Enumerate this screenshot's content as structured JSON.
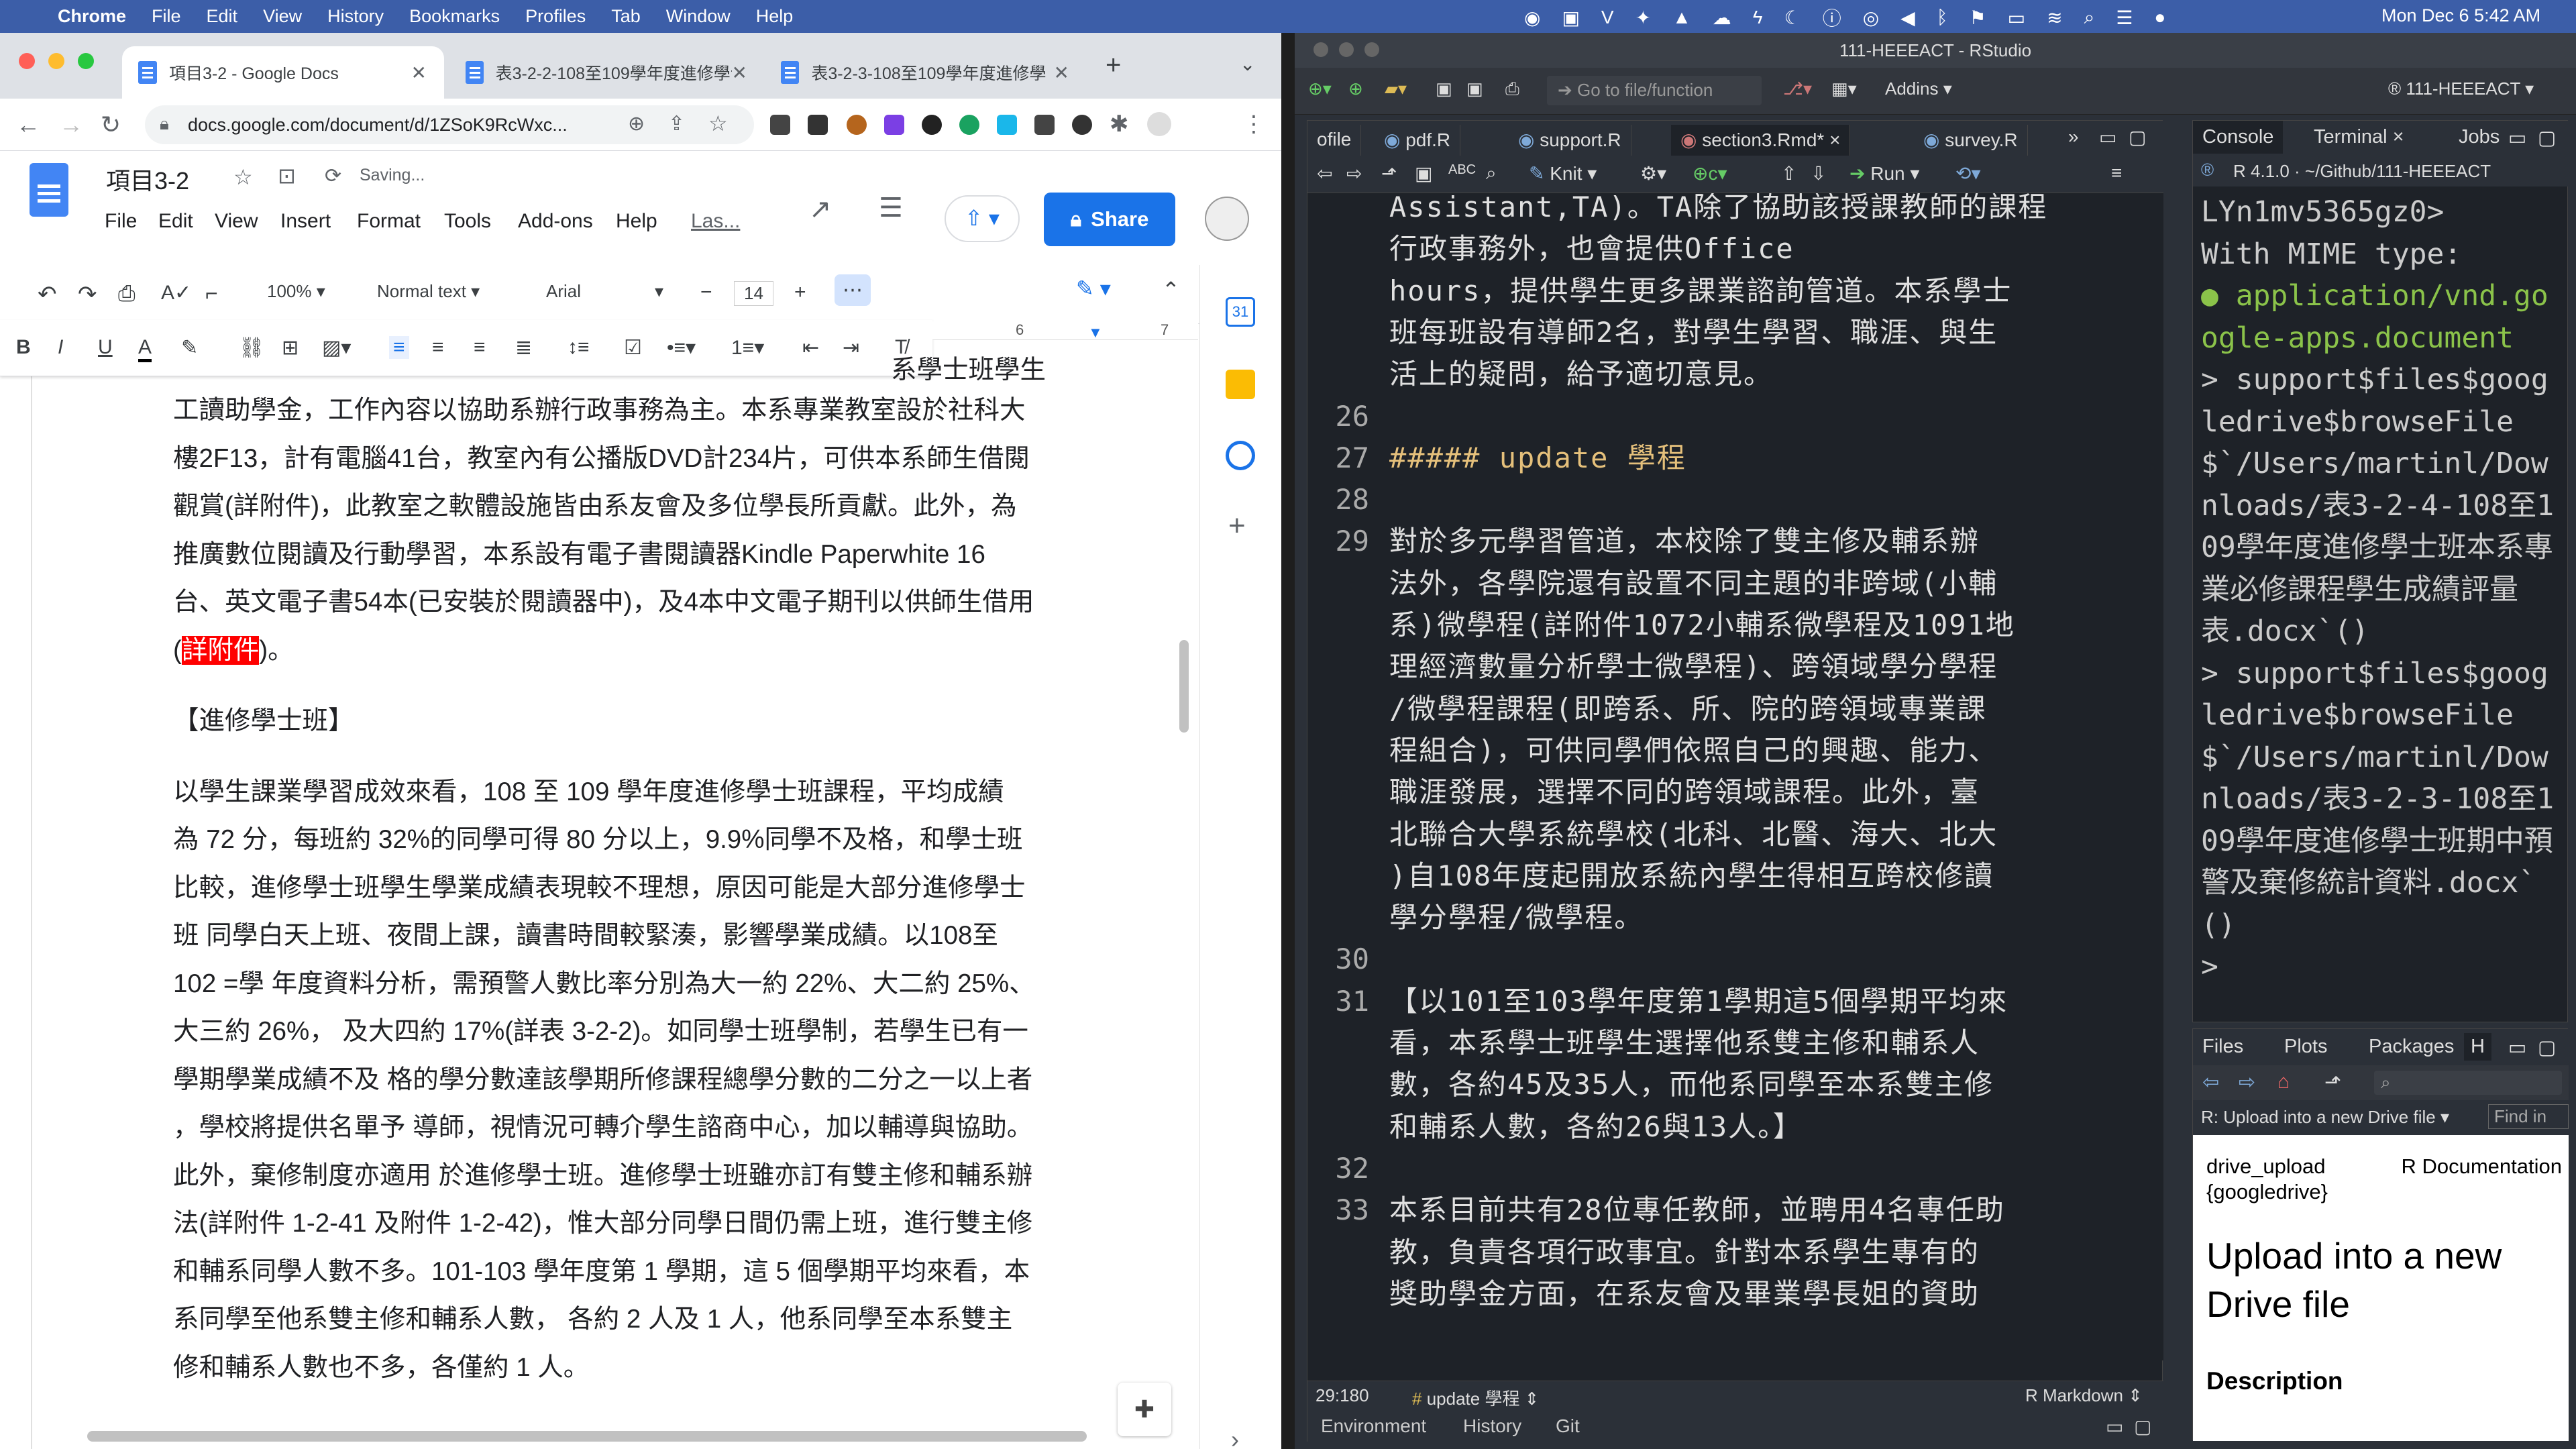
{
  "menubar": {
    "app": "Chrome",
    "items": [
      "File",
      "Edit",
      "View",
      "History",
      "Bookmarks",
      "Profiles",
      "Tab",
      "Window",
      "Help"
    ],
    "datetime": "Mon Dec 6  5:42 AM"
  },
  "chrome": {
    "tabs": [
      {
        "label": "項目3-2 - Google Docs"
      },
      {
        "label": "表3-2-2-108至109學年度進修學士班"
      },
      {
        "label": "表3-2-3-108至109學年度進修學"
      }
    ],
    "url": "docs.google.com/document/d/1ZSoK9RcWxc...",
    "doc_title": "項目3-2",
    "saving": "Saving...",
    "share": "Share",
    "menu": [
      "File",
      "Edit",
      "View",
      "Insert",
      "Format",
      "Tools",
      "Add-ons",
      "Help",
      "Las..."
    ],
    "zoom": "100%",
    "style": "Normal text",
    "font": "Arial",
    "size": "14",
    "ruler": [
      "6",
      "7"
    ]
  },
  "doc": {
    "para1_line0": "系學士班學生",
    "para1_lines": [
      "工讀助學金，工作內容以協助系辦行政事務為主。本系專業教室設於社科大",
      "樓2F13，計有電腦41台，教室內有公播版DVD計234片，可供本系師生借閱",
      "觀賞(詳附件)，此教室之軟體設施皆由系友會及多位學長所貢獻。此外，為",
      "推廣數位閱讀及行動學習，本系設有電子書閱讀器Kindle Paperwhite 16",
      "台、英文電子書54本(已安裝於閱讀器中)，及4本中文電子期刊以供師生借用"
    ],
    "para1_last_pre": "(",
    "para1_highlight": "詳附件",
    "para1_last_post": ")。",
    "heading": "【進修學士班】",
    "para2_lines": [
      "以學生課業學習成效來看，108 至 109 學年度進修學士班課程，平均成績",
      "為 72 分，每班約 32%的同學可得 80 分以上，9.9%同學不及格，和學士班",
      "比較，進修學士班學生學業成績表現較不理想，原因可能是大部分進修學士",
      "班 同學白天上班、夜間上課，讀書時間較緊湊，影響學業成績。以108至",
      "102 =學 年度資料分析，需預警人數比率分別為大一約 22%、大二約 25%、",
      "大三約 26%， 及大四約 17%(詳表 3-2-2)。如同學士班學制，若學生已有一",
      "學期學業成績不及 格的學分數達該學期所修課程總學分數的二分之一以上者",
      "，學校將提供名單予 導師，視情況可轉介學生諮商中心，加以輔導與協助。",
      "此外，棄修制度亦適用 於進修學士班。進修學士班雖亦訂有雙主修和輔系辦",
      "法(詳附件 1-2-41 及附件 1-2-42)，惟大部分同學日間仍需上班，進行雙主修",
      "和輔系同學人數不多。101-103 學年度第 1 學期，這 5 個學期平均來看，本",
      "系同學至他系雙主修和輔系人數， 各約 2 人及 1 人，他系同學至本系雙主",
      "修和輔系人數也不多，各僅約 1 人。"
    ]
  },
  "rstudio": {
    "title": "111-HEEEACT - RStudio",
    "goto": "Go to file/function",
    "addins": "Addins",
    "project": "111-HEEEACT",
    "editor_tabs": [
      "ofile",
      "pdf.R",
      "support.R",
      "section3.Rmd*",
      "survey.R"
    ],
    "knit": "Knit",
    "run": "Run",
    "code_top": [
      "Assistant,TA)。TA除了協助該授課教師的課程",
      "行政事務外，也會提供Office",
      "hours，提供學生更多課業諮詢管道。本系學士",
      "班每班設有導師2名，對學生學習、職涯、與生",
      "活上的疑問，給予適切意見。"
    ],
    "lines": [
      {
        "n": "26",
        "t": [
          ""
        ]
      },
      {
        "n": "27",
        "t": [
          "##### update 學程"
        ],
        "hdr": true
      },
      {
        "n": "28",
        "t": [
          ""
        ]
      },
      {
        "n": "29",
        "t": [
          "對於多元學習管道，本校除了雙主修及輔系辦",
          "法外，各學院還有設置不同主題的非跨域(小輔",
          "系)微學程(詳附件1072小輔系微學程及1091地",
          "理經濟數量分析學士微學程)、跨領域學分學程",
          "/微學程課程(即跨系、所、院的跨領域專業課",
          "程組合)，可供同學們依照自己的興趣、能力、",
          "職涯發展，選擇不同的跨領域課程。此外，臺",
          "北聯合大學系統學校(北科、北醫、海大、北大",
          ")自108年度起開放系統內學生得相互跨校修讀",
          "學分學程/微學程。"
        ]
      },
      {
        "n": "30",
        "t": [
          ""
        ]
      },
      {
        "n": "31",
        "t": [
          "【以101至103學年度第1學期這5個學期平均來",
          "看，本系學士班學生選擇他系雙主修和輔系人",
          "數，各約45及35人，而他系同學至本系雙主修",
          "和輔系人數，各約26與13人。】"
        ]
      },
      {
        "n": "32",
        "t": [
          ""
        ]
      },
      {
        "n": "33",
        "t": [
          "本系目前共有28位專任教師，並聘用4名專任助",
          "教，負責各項行政事宜。針對本系學生專有的",
          "獎助學金方面，在系友會及畢業學長姐的資助"
        ]
      }
    ],
    "status_pos": "29:180",
    "status_section": "update 學程",
    "status_mode": "R Markdown",
    "env_tabs": [
      "Environment",
      "History",
      "Git"
    ],
    "console_tabs": [
      "Console",
      "Terminal",
      "Jobs"
    ],
    "r_version": "R 4.1.0 · ~/Github/111-HEEEACT",
    "console_lines": [
      {
        "cls": "",
        "t": "LYn1mv5365gz0>"
      },
      {
        "cls": "",
        "t": "With MIME type:"
      },
      {
        "cls": "mime",
        "t": "● application/vnd.google-apps.document"
      },
      {
        "cls": "",
        "t": "> support$files$googledrive$browseFile$`/Users/martinl/Downloads/表3-2-4-108至109學年度進修學士班本系專業必修課程學生成績評量表.docx`()"
      },
      {
        "cls": "",
        "t": "> support$files$googledrive$browseFile$`/Users/martinl/Downloads/表3-2-3-108至109學年度進修學士班期中預警及棄修統計資料.docx`()"
      },
      {
        "cls": "",
        "t": ">"
      }
    ],
    "files_tabs": [
      "Files",
      "Plots",
      "Packages",
      "H"
    ],
    "help_topic": "R: Upload into a new Drive file",
    "help_find": "Find in",
    "help_pkg": "drive_upload {googledrive}",
    "help_r": "R Documentation",
    "help_title": "Upload into a new Drive file",
    "help_desc": "Description"
  }
}
